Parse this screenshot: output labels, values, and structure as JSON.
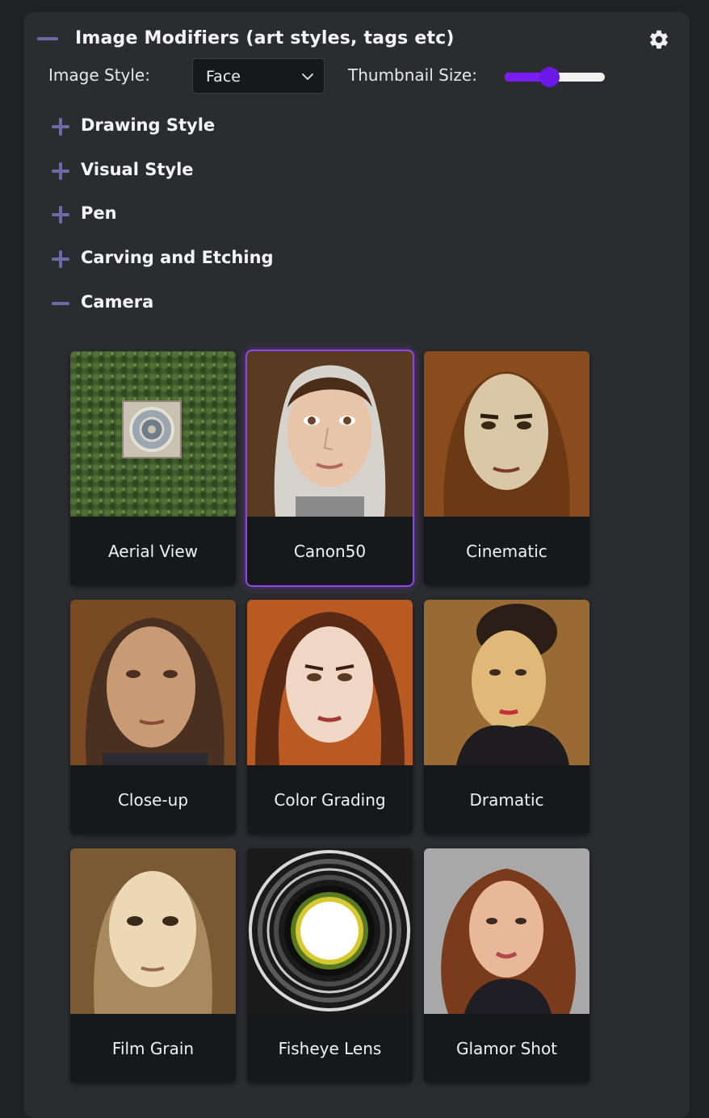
{
  "header": {
    "title": "Image Modifiers (art styles, tags etc)"
  },
  "controls": {
    "image_style_label": "Image Style:",
    "image_style_value": "Face",
    "thumbnail_size_label": "Thumbnail Size:",
    "thumbnail_size_fraction": 0.45
  },
  "sections": [
    {
      "label": "Drawing Style",
      "expanded": false
    },
    {
      "label": "Visual Style",
      "expanded": false
    },
    {
      "label": "Pen",
      "expanded": false
    },
    {
      "label": "Carving and Etching",
      "expanded": false
    },
    {
      "label": "Camera",
      "expanded": true
    }
  ],
  "cards": [
    {
      "label": "Aerial View",
      "selected": false
    },
    {
      "label": "Canon50",
      "selected": true
    },
    {
      "label": "Cinematic",
      "selected": false
    },
    {
      "label": "Close-up",
      "selected": false
    },
    {
      "label": "Color Grading",
      "selected": false
    },
    {
      "label": "Dramatic",
      "selected": false
    },
    {
      "label": "Film Grain",
      "selected": false
    },
    {
      "label": "Fisheye Lens",
      "selected": false
    },
    {
      "label": "Glamor Shot",
      "selected": false
    }
  ],
  "colors": {
    "accent": "#7a1df5",
    "icon": "#6d6aa8",
    "panel": "#2b2c30",
    "background": "#202124"
  }
}
